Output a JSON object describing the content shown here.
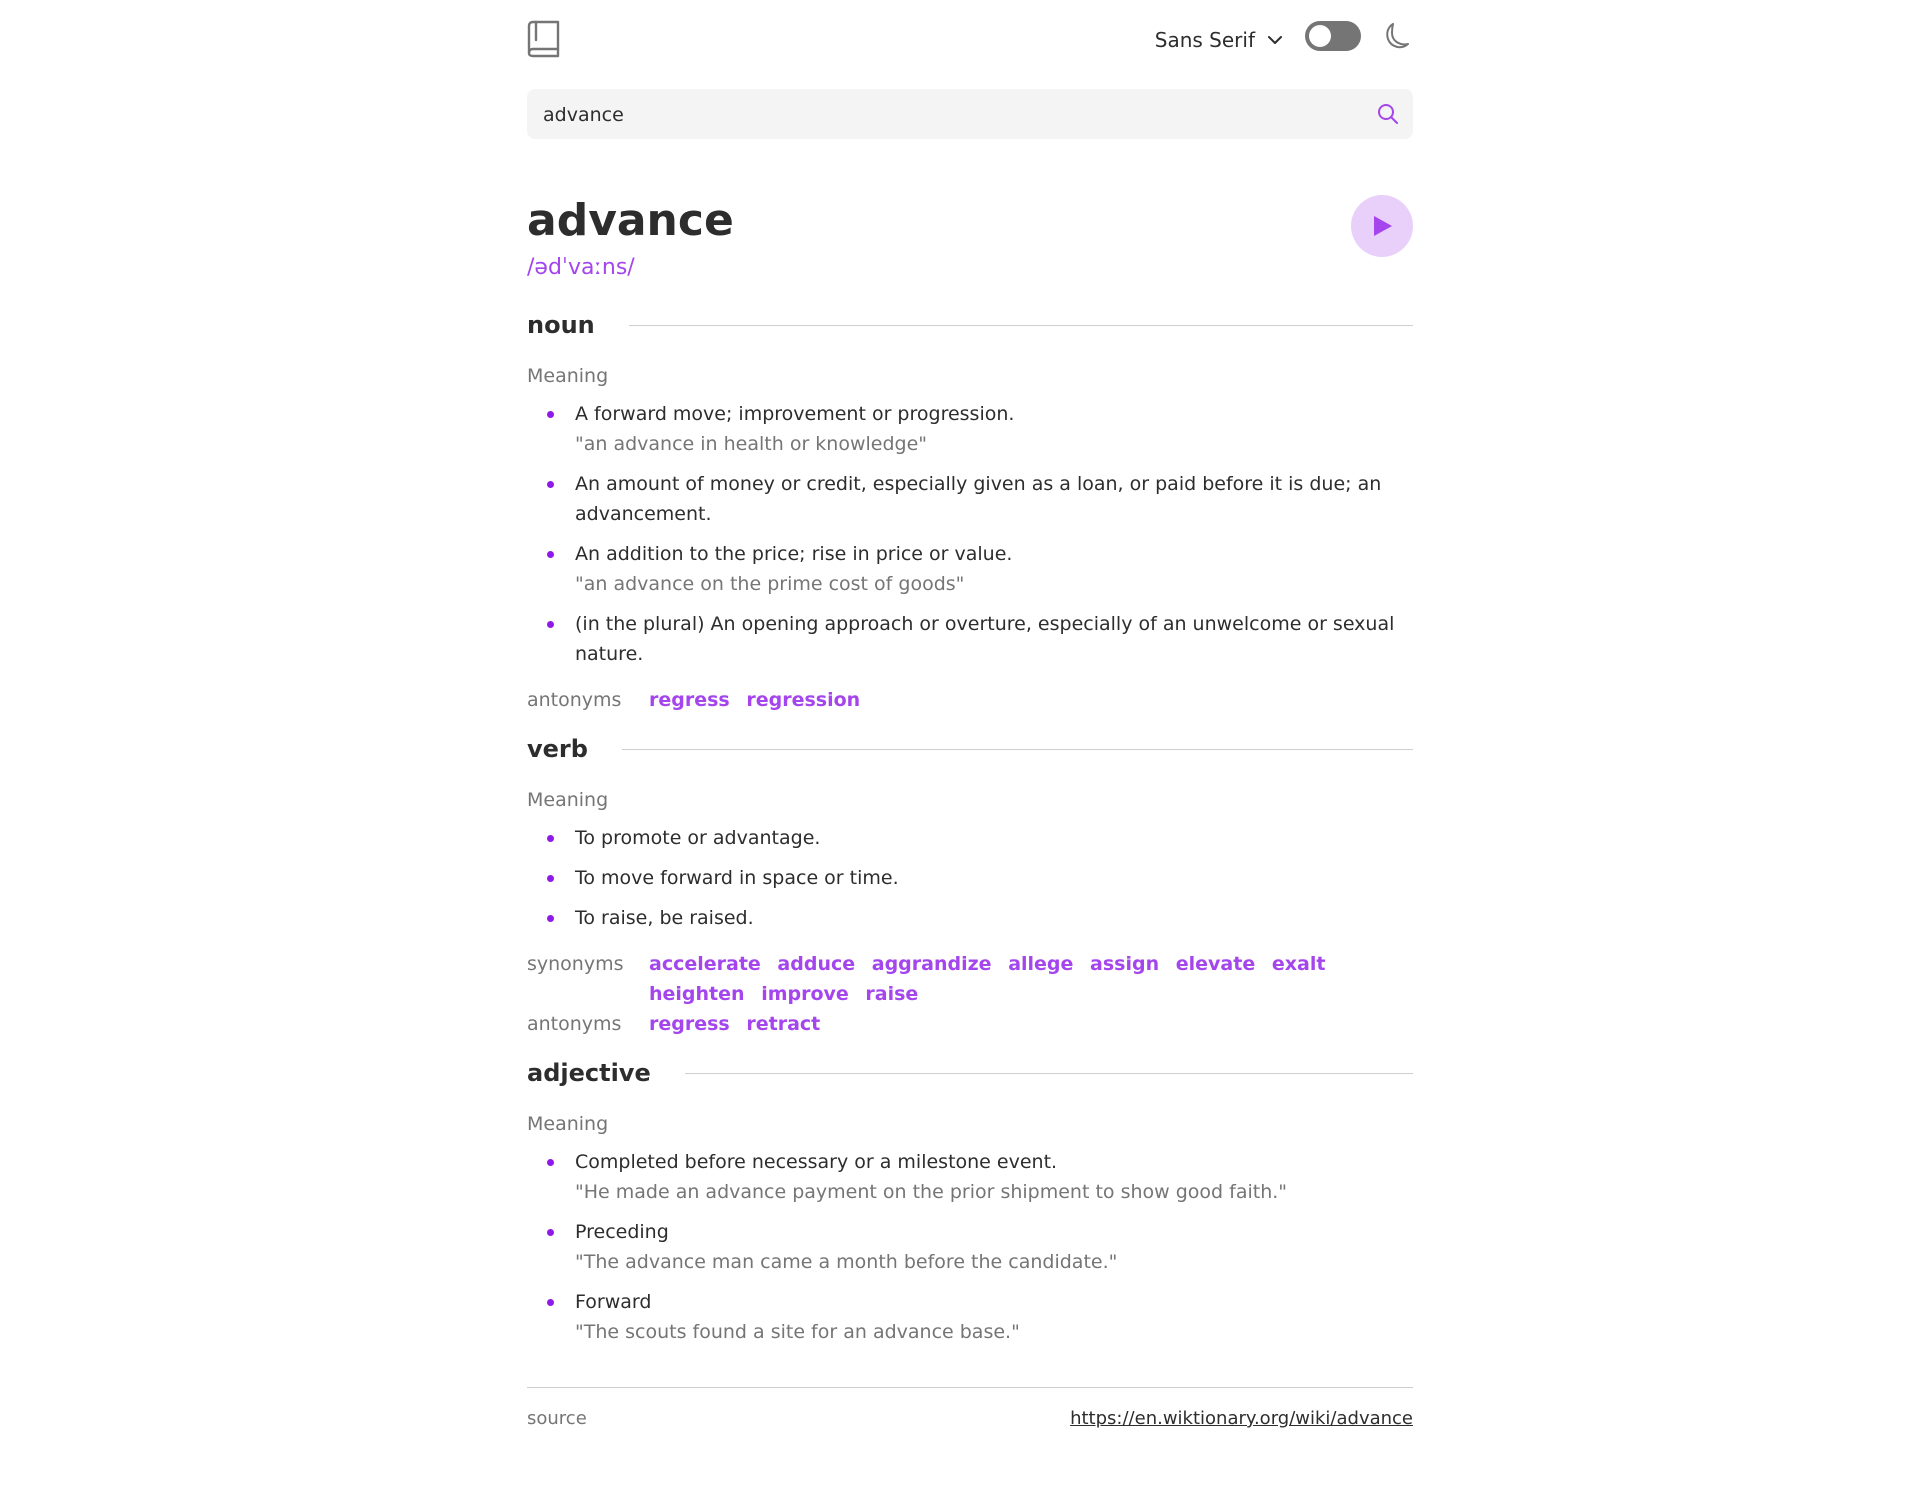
{
  "header": {
    "font_label": "Sans Serif"
  },
  "search": {
    "value": "advance"
  },
  "word": {
    "title": "advance",
    "phonetic": "/ədˈvaːns/"
  },
  "meanings": [
    {
      "pos": "noun",
      "meaning_label": "Meaning",
      "definitions": [
        {
          "text": "A forward move; improvement or progression.",
          "example": "\"an advance in health or knowledge\""
        },
        {
          "text": "An amount of money or credit, especially given as a loan, or paid before it is due; an advancement.",
          "example": ""
        },
        {
          "text": "An addition to the price; rise in price or value.",
          "example": "\"an advance on the prime cost of goods\""
        },
        {
          "text": "(in the plural) An opening approach or overture, especially of an unwelcome or sexual nature.",
          "example": ""
        }
      ],
      "antonyms_label": "antonyms",
      "antonyms": [
        "regress",
        "regression"
      ]
    },
    {
      "pos": "verb",
      "meaning_label": "Meaning",
      "definitions": [
        {
          "text": "To promote or advantage.",
          "example": ""
        },
        {
          "text": "To move forward in space or time.",
          "example": ""
        },
        {
          "text": "To raise, be raised.",
          "example": ""
        }
      ],
      "synonyms_label": "synonyms",
      "synonyms": [
        "accelerate",
        "adduce",
        "aggrandize",
        "allege",
        "assign",
        "elevate",
        "exalt",
        "heighten",
        "improve",
        "raise"
      ],
      "antonyms_label": "antonyms",
      "antonyms": [
        "regress",
        "retract"
      ]
    },
    {
      "pos": "adjective",
      "meaning_label": "Meaning",
      "definitions": [
        {
          "text": "Completed before necessary or a milestone event.",
          "example": "\"He made an advance payment on the prior shipment to show good faith.\""
        },
        {
          "text": "Preceding",
          "example": "\"The advance man came a month before the candidate.\""
        },
        {
          "text": "Forward",
          "example": "\"The scouts found a site for an advance base.\""
        }
      ]
    }
  ],
  "footer": {
    "source_label": "source",
    "source_url": "https://en.wiktionary.org/wiki/advance"
  },
  "colors": {
    "accent": "#a445ed",
    "play_bg": "#e9d0fa",
    "text": "#2d2d2d",
    "muted": "#757575"
  },
  "icons": {
    "logo": "book-icon",
    "dropdown": "chevron-down-icon",
    "theme": "moon-icon",
    "search": "search-icon",
    "play": "play-icon"
  }
}
